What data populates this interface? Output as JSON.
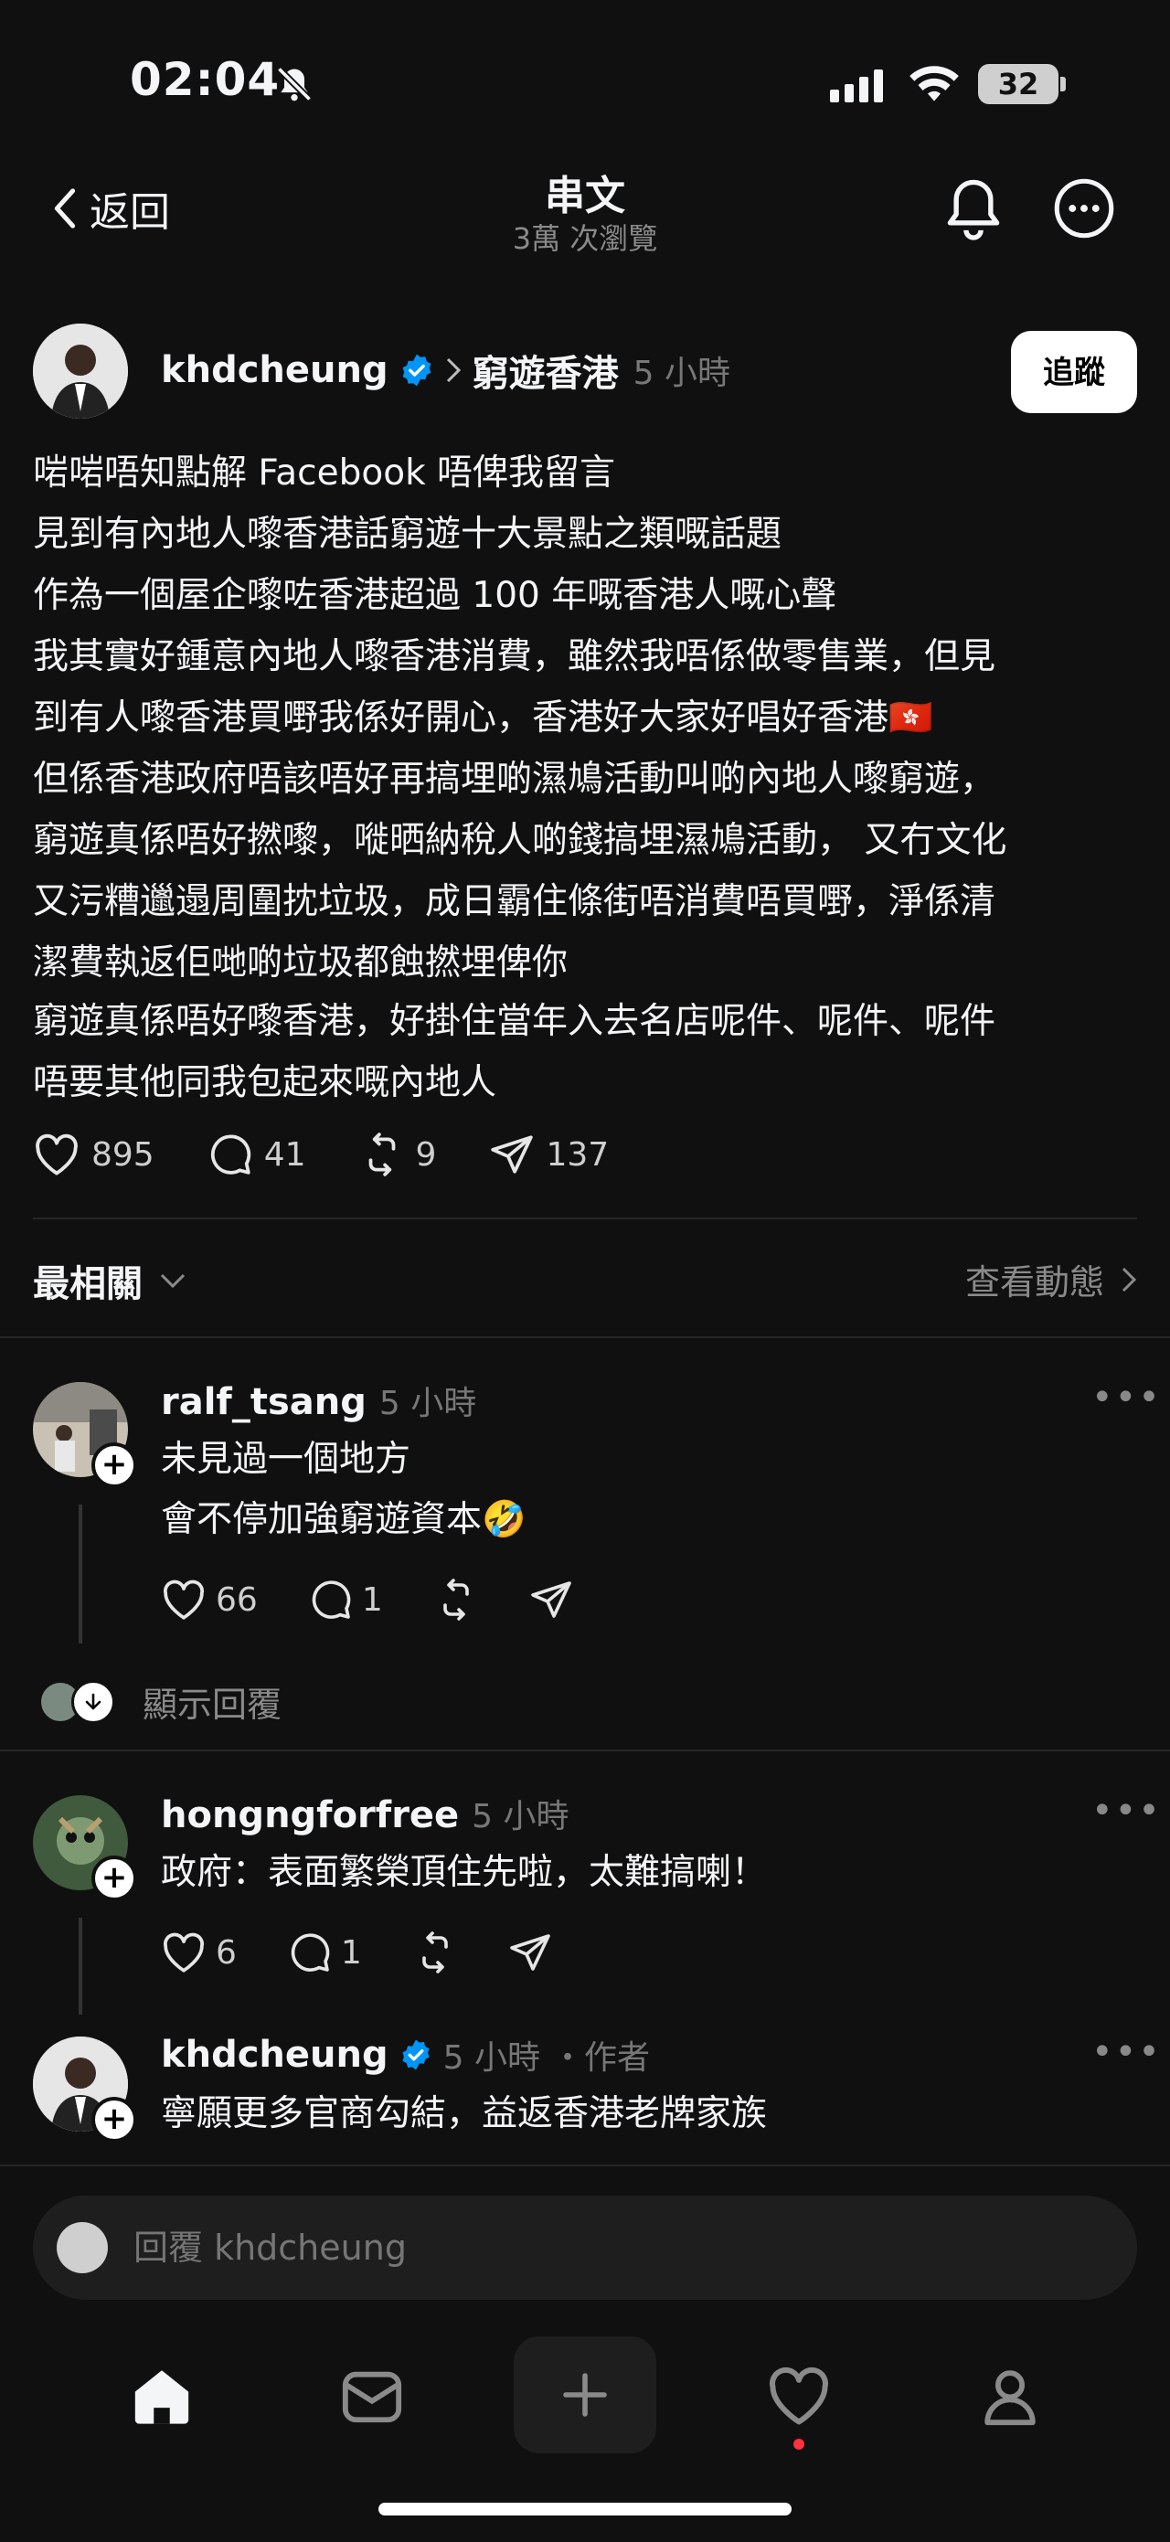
{
  "status": {
    "time": "02:04",
    "battery": "32"
  },
  "header": {
    "back_label": "返回",
    "title": "串文",
    "subtitle": "3萬 次瀏覽"
  },
  "post": {
    "username": "khdcheung",
    "topic": "窮遊香港",
    "time": "5 小時",
    "follow_label": "追蹤",
    "lines": [
      "啱啱唔知點解 Facebook 唔俾我留言",
      "見到有內地人嚟香港話窮遊十大景點之類嘅話題",
      "作為一個屋企嚟咗香港超過 100 年嘅香港人嘅心聲",
      "我其實好鍾意內地人嚟香港消費，雖然我唔係做零售業，但見",
      "到有人嚟香港買嘢我係好開心，香港好大家好唱好香港🇭🇰",
      "但係香港政府唔該唔好再搞埋啲濕鳩活動叫啲內地人嚟窮遊，",
      "窮遊真係唔好撚嚟，嘥晒納稅人啲錢搞埋濕鳩活動， 又冇文化",
      "又污糟邋遢周圍抌垃圾，成日霸住條街唔消費唔買嘢，淨係清",
      "潔費執返佢哋啲垃圾都蝕撚埋俾你"
    ],
    "lines2": [
      "窮遊真係唔好嚟香港，好掛住當年入去名店呢件、呢件、呢件",
      "唔要其他同我包起來嘅內地人"
    ],
    "likes": "895",
    "comments": "41",
    "reposts": "9",
    "shares": "137"
  },
  "sort": {
    "label": "最相關",
    "activity": "查看動態"
  },
  "replies": [
    {
      "username": "ralf_tsang",
      "time": "5 小時",
      "lines": [
        "未見過一個地方",
        "會不停加強窮遊資本🤣"
      ],
      "likes": "66",
      "comments": "1",
      "show_replies": "顯示回覆"
    },
    {
      "username": "hongngforfree",
      "time": "5 小時",
      "lines": [
        "政府：表面繁榮頂住先啦，太難搞喇！"
      ],
      "likes": "6",
      "comments": "1"
    },
    {
      "username": "khdcheung",
      "time": "5 小時",
      "author_tag": "・作者",
      "lines": [
        "寧願更多官商勾結，益返香港老牌家族"
      ]
    }
  ],
  "reply_bar": {
    "placeholder": "回覆 khdcheung"
  },
  "colors": {
    "background": "#101010",
    "verified": "#0095f6",
    "notification_dot": "#ff3040"
  }
}
